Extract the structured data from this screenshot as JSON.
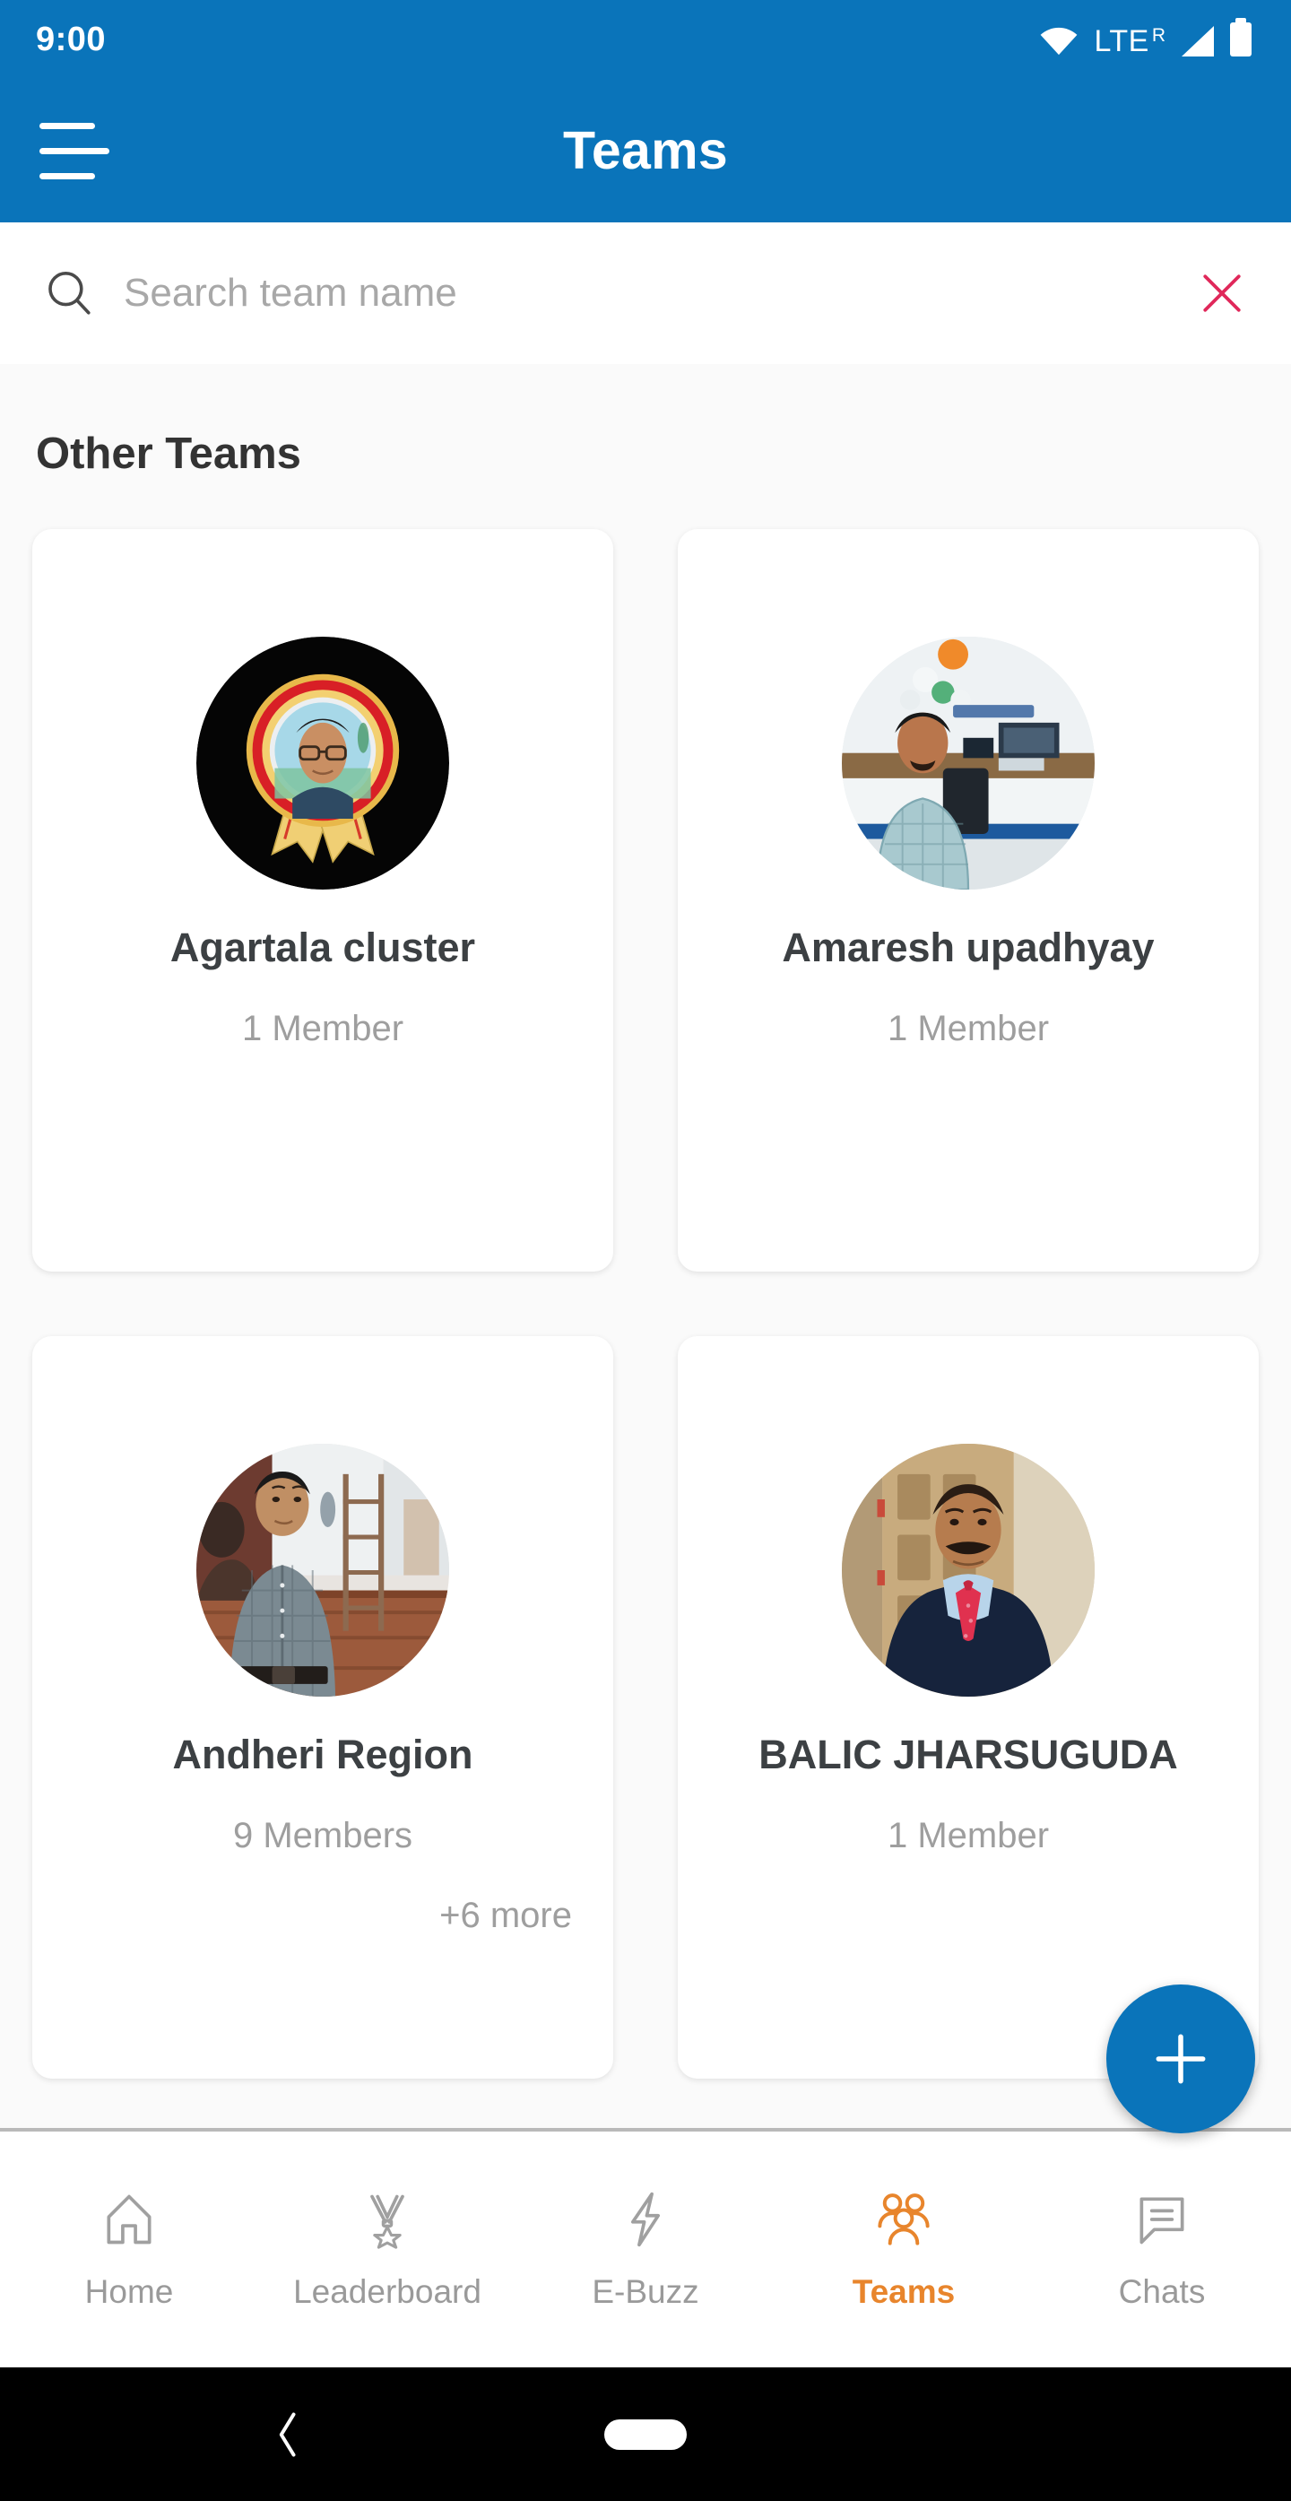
{
  "status_bar": {
    "time": "9:00",
    "network_label": "LTE",
    "roaming_indicator": "R",
    "icons": [
      "wifi-icon",
      "signal-icon",
      "battery-icon"
    ]
  },
  "app_bar": {
    "title": "Teams",
    "menu_icon": "hamburger-menu-icon",
    "background_color": "#0a74ba"
  },
  "search": {
    "placeholder": "Search team name",
    "value": "",
    "search_icon": "search-icon",
    "clear_icon": "close-icon",
    "clear_icon_color": "#e0285a"
  },
  "main": {
    "section_title": "Other Teams",
    "teams": [
      {
        "name": "Agartala cluster",
        "member_count": "1 Member",
        "more": "",
        "avatar": "medal-badge-portrait"
      },
      {
        "name": "Amaresh upadhyay",
        "member_count": "1 Member",
        "more": "",
        "avatar": "office-portrait"
      },
      {
        "name": "Andheri Region",
        "member_count": "9 Members",
        "more": "+6 more",
        "avatar": "hall-portrait"
      },
      {
        "name": "BALIC JHARSUGUDA",
        "member_count": "1 Member",
        "more": "",
        "avatar": "suit-portrait"
      }
    ]
  },
  "fab": {
    "label": "+",
    "icon": "plus-icon",
    "color": "#0a74ba"
  },
  "bottom_nav": {
    "active_color": "#e8852c",
    "inactive_color": "#9a9a9a",
    "items": [
      {
        "label": "Home",
        "icon": "home-icon",
        "active": false
      },
      {
        "label": "Leaderboard",
        "icon": "medal-icon",
        "active": false
      },
      {
        "label": "E-Buzz",
        "icon": "lightning-bolt-icon",
        "active": false
      },
      {
        "label": "Teams",
        "icon": "people-group-icon",
        "active": true
      },
      {
        "label": "Chats",
        "icon": "chat-bubble-icon",
        "active": false
      }
    ]
  },
  "android_nav": {
    "back_icon": "back-chevron-icon",
    "home_icon": "home-pill-icon"
  }
}
